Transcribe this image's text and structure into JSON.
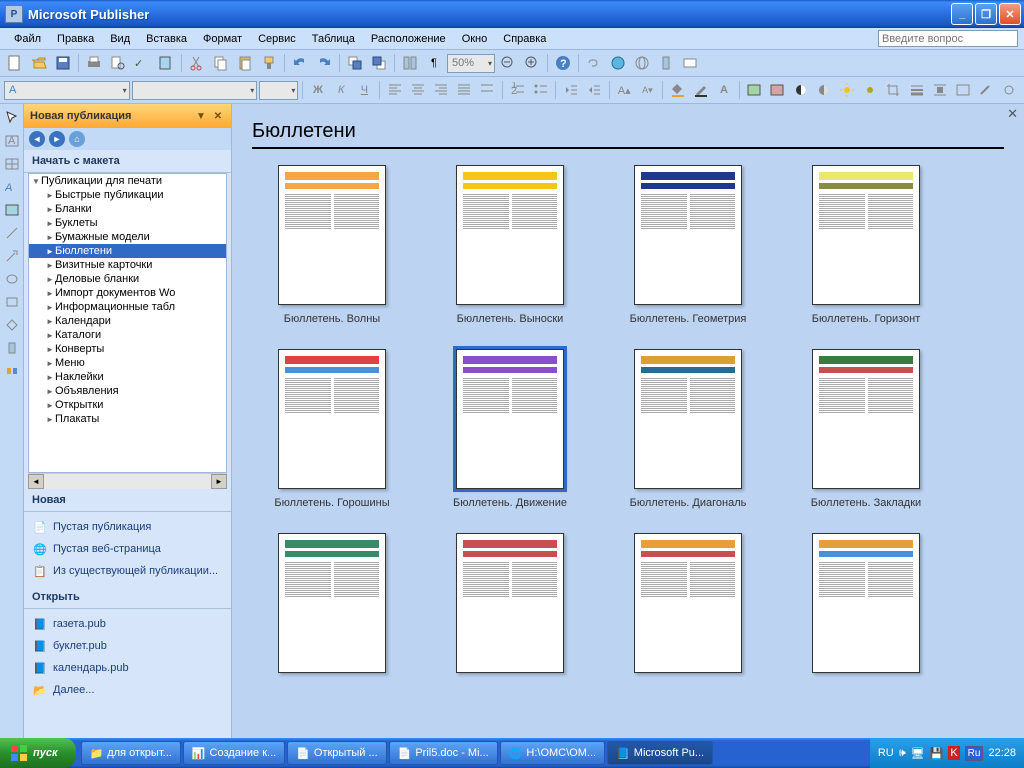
{
  "app": {
    "title": "Microsoft Publisher",
    "icon_letter": "P"
  },
  "window_buttons": {
    "min": "_",
    "max": "❐",
    "close": "✕"
  },
  "menus": [
    "Файл",
    "Правка",
    "Вид",
    "Вставка",
    "Формат",
    "Сервис",
    "Таблица",
    "Расположение",
    "Окно",
    "Справка"
  ],
  "help_placeholder": "Введите вопрос",
  "zoom_value": "50%",
  "taskpane": {
    "title": "Новая публикация",
    "section_start": "Начать с макета",
    "tree_top": "Публикации для печати",
    "tree_items": [
      "Быстрые публикации",
      "Бланки",
      "Буклеты",
      "Бумажные модели",
      "Бюллетени",
      "Визитные карточки",
      "Деловые бланки",
      "Импорт документов Wo",
      "Информационные табл",
      "Календари",
      "Каталоги",
      "Конверты",
      "Меню",
      "Наклейки",
      "Объявления",
      "Открытки",
      "Плакаты"
    ],
    "tree_selected_index": 4,
    "section_new": "Новая",
    "new_links": [
      "Пустая публикация",
      "Пустая веб-страница",
      "Из существующей публикации..."
    ],
    "section_open": "Открыть",
    "open_links": [
      "газета.pub",
      "буклет.pub",
      "календарь.pub",
      "Далее..."
    ]
  },
  "gallery": {
    "heading": "Бюллетени",
    "selected_index": 5,
    "items": [
      {
        "label": "Бюллетень. Волны",
        "accent": "#f4a742",
        "head": "#f4a742"
      },
      {
        "label": "Бюллетень. Выноски",
        "accent": "#f5c518",
        "head": "#f5c518"
      },
      {
        "label": "Бюллетень. Геометрия",
        "accent": "#1e3a8a",
        "head": "#1e3a8a"
      },
      {
        "label": "Бюллетень. Горизонт",
        "accent": "#8a8a4a",
        "head": "#e8e86a"
      },
      {
        "label": "Бюллетень. Горошины",
        "accent": "#4a90d9",
        "head": "#d44"
      },
      {
        "label": "Бюллетень. Движение",
        "accent": "#8a4fc7",
        "head": "#8a4fc7"
      },
      {
        "label": "Бюллетень. Диагональ",
        "accent": "#2a6b8f",
        "head": "#d9a035"
      },
      {
        "label": "Бюллетень. Закладки",
        "accent": "#c74f4f",
        "head": "#3a7a3a"
      },
      {
        "label": "",
        "accent": "#3a8a6a",
        "head": "#3a8a6a"
      },
      {
        "label": "",
        "accent": "#c74f4f",
        "head": "#c74f4f"
      },
      {
        "label": "",
        "accent": "#c74f4f",
        "head": "#e89f3a"
      },
      {
        "label": "",
        "accent": "#4a90d9",
        "head": "#e89f3a"
      }
    ]
  },
  "taskbar": {
    "start": "пуск",
    "buttons": [
      {
        "label": "для открыт...",
        "icon": "📁"
      },
      {
        "label": "Создание к...",
        "icon": "📊"
      },
      {
        "label": "Открытый ...",
        "icon": "📄"
      },
      {
        "label": "Pril5.doc - Mi...",
        "icon": "📄"
      },
      {
        "label": "H:\\OMC\\OM...",
        "icon": "🌐"
      },
      {
        "label": "Microsoft Pu...",
        "icon": "📘",
        "active": true
      }
    ],
    "tray": {
      "lang1": "RU",
      "lang2": "Ru",
      "clock": "22:28"
    }
  }
}
